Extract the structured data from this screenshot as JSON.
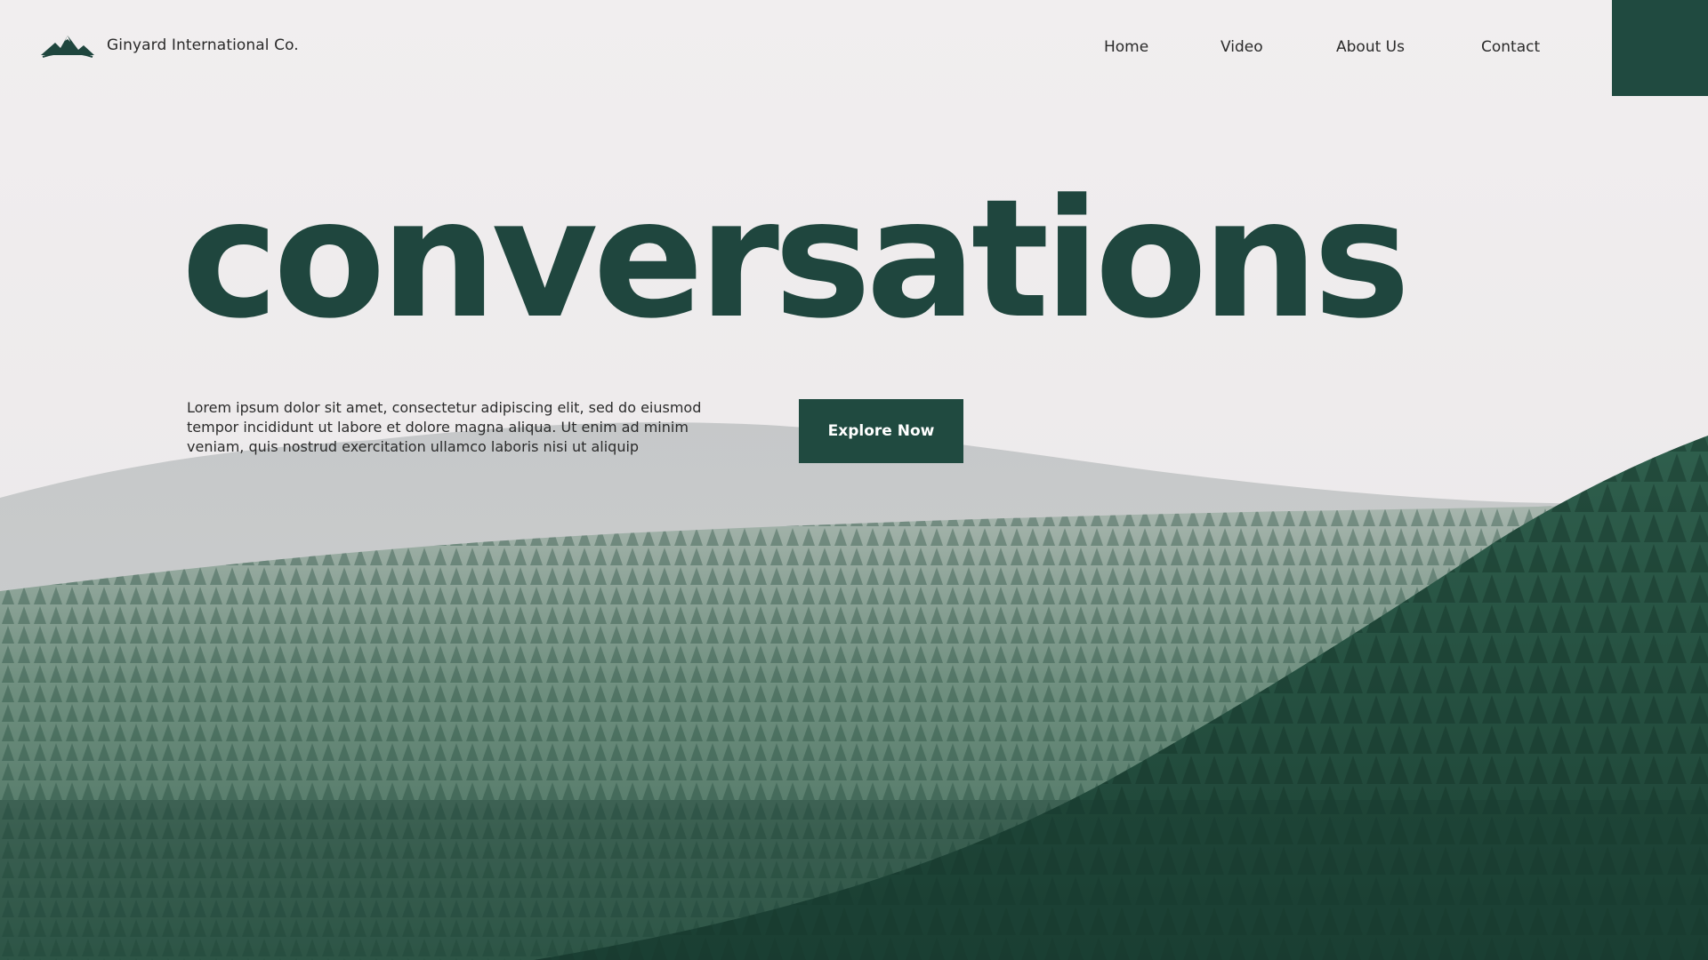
{
  "brand": {
    "name": "Ginyard International Co.",
    "logo_icon": "mountain-logo-icon"
  },
  "nav": {
    "items": [
      {
        "label": "Home"
      },
      {
        "label": "Video"
      },
      {
        "label": "About Us"
      },
      {
        "label": "Contact"
      }
    ],
    "menu_icon": "menu-block"
  },
  "hero": {
    "title": "conversations",
    "description": "Lorem ipsum dolor sit amet, consectetur adipiscing elit, sed do eiusmod tempor incididunt ut labore et dolore magna aliqua. Ut enim ad minim veniam, quis nostrud exercitation ullamco laboris nisi ut aliquip",
    "cta_label": "Explore Now"
  },
  "colors": {
    "accent": "#204a40",
    "title": "#1f463e",
    "text": "#2a2a2a",
    "sky": "#efeced",
    "forest": "#2f5a49"
  }
}
